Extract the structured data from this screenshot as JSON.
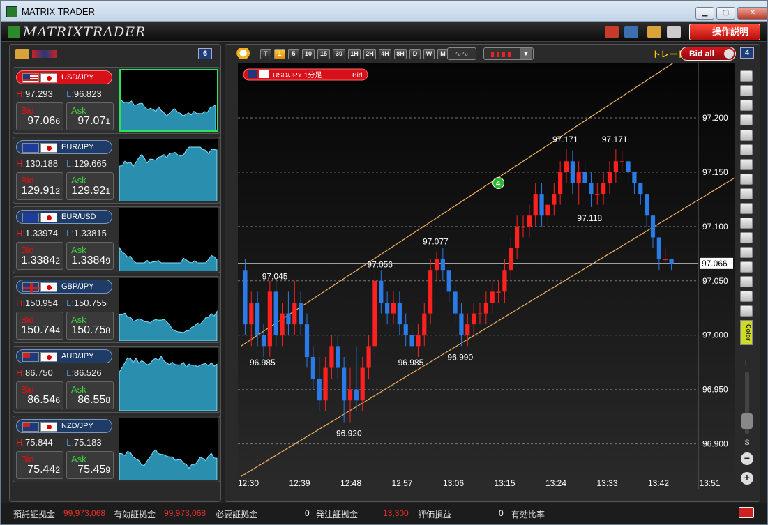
{
  "window": {
    "title": "MATRIX TRADER",
    "logo": "MATRIXTRADER"
  },
  "toolbar": {
    "help_label": "操作説明",
    "icons": [
      "briefcase-icon",
      "save-icon",
      "palette-icon",
      "printer-icon"
    ]
  },
  "left_panel": {
    "count": "6",
    "pairs": [
      {
        "name": "USD/JPY",
        "flags": [
          "us",
          "jp"
        ],
        "h": "97.293",
        "l": "96.823",
        "bid_main": "97.06",
        "bid_small": "6",
        "ask_main": "97.07",
        "ask_small": "1",
        "active": true
      },
      {
        "name": "EUR/JPY",
        "flags": [
          "eu",
          "jp"
        ],
        "h": "130.188",
        "l": "129.665",
        "bid_main": "129.91",
        "bid_small": "2",
        "ask_main": "129.92",
        "ask_small": "1",
        "active": false
      },
      {
        "name": "EUR/USD",
        "flags": [
          "eu",
          "us"
        ],
        "h": "1.33974",
        "l": "1.33815",
        "bid_main": "1.3384",
        "bid_small": "2",
        "ask_main": "1.3384",
        "ask_small": "9",
        "active": false
      },
      {
        "name": "GBP/JPY",
        "flags": [
          "gb",
          "jp"
        ],
        "h": "150.954",
        "l": "150.755",
        "bid_main": "150.74",
        "bid_small": "4",
        "ask_main": "150.75",
        "ask_small": "8",
        "active": false
      },
      {
        "name": "AUD/JPY",
        "flags": [
          "au",
          "jp"
        ],
        "h": "86.750",
        "l": "86.526",
        "bid_main": "86.54",
        "bid_small": "6",
        "ask_main": "86.55",
        "ask_small": "8",
        "active": false
      },
      {
        "name": "NZD/JPY",
        "flags": [
          "nz",
          "jp"
        ],
        "h": "75.844",
        "l": "75.183",
        "bid_main": "75.44",
        "bid_small": "2",
        "ask_main": "75.45",
        "ask_small": "9",
        "active": false
      }
    ],
    "h_prefix": "H:",
    "l_prefix": "L:",
    "bid_label": "Bid",
    "ask_label": "Ask"
  },
  "chart_toolbar": {
    "timeframes": [
      "T",
      "1",
      "5",
      "10",
      "15",
      "30",
      "1H",
      "2H",
      "4H",
      "8H",
      "D",
      "W",
      "M"
    ],
    "selected_timeframe": "1",
    "trade_label": "トレード",
    "bid_all_label": "Bid all",
    "panel_count": "4"
  },
  "chart_data": {
    "type": "candlestick",
    "title": "USD/JPY 1分足",
    "price_type": "Bid",
    "y_ticks": [
      "97.200",
      "97.150",
      "97.100",
      "97.050",
      "97.000",
      "96.950",
      "96.900"
    ],
    "ylim": [
      96.86,
      97.25
    ],
    "x_ticks": [
      "12:30",
      "12:39",
      "12:48",
      "12:57",
      "13:06",
      "13:15",
      "13:24",
      "13:33",
      "13:42",
      "13:51"
    ],
    "current_price": "97.066",
    "annotations": [
      "97.045",
      "96.985",
      "96.920",
      "97.056",
      "97.077",
      "96.985",
      "96.990",
      "97.171",
      "97.171",
      "97.118"
    ],
    "channel_marker": "4",
    "candles": [
      [
        97.06,
        97.07,
        97.0,
        97.01
      ],
      [
        97.01,
        97.04,
        96.99,
        97.03
      ],
      [
        97.03,
        97.04,
        96.99,
        97.0
      ],
      [
        97.0,
        97.01,
        96.98,
        96.99
      ],
      [
        96.99,
        97.05,
        96.98,
        97.04
      ],
      [
        97.04,
        97.05,
        96.99,
        97.0
      ],
      [
        97.0,
        97.03,
        96.99,
        97.02
      ],
      [
        97.02,
        97.04,
        97.0,
        97.01
      ],
      [
        97.01,
        97.05,
        97.0,
        97.03
      ],
      [
        97.03,
        97.04,
        97.0,
        97.01
      ],
      [
        97.01,
        97.02,
        96.97,
        96.98
      ],
      [
        96.98,
        96.99,
        96.95,
        96.96
      ],
      [
        96.96,
        96.98,
        96.93,
        96.94
      ],
      [
        96.94,
        96.98,
        96.93,
        96.97
      ],
      [
        96.97,
        97.0,
        96.96,
        96.99
      ],
      [
        96.99,
        97.0,
        96.96,
        96.97
      ],
      [
        96.97,
        96.98,
        96.92,
        96.94
      ],
      [
        96.94,
        96.97,
        96.92,
        96.95
      ],
      [
        96.95,
        96.99,
        96.93,
        96.94
      ],
      [
        96.94,
        96.98,
        96.93,
        96.97
      ],
      [
        96.97,
        97.0,
        96.96,
        96.99
      ],
      [
        96.99,
        97.06,
        96.98,
        97.05
      ],
      [
        97.05,
        97.06,
        97.02,
        97.03
      ],
      [
        97.03,
        97.04,
        97.01,
        97.02
      ],
      [
        97.02,
        97.04,
        97.01,
        97.03
      ],
      [
        97.03,
        97.04,
        97.0,
        97.01
      ],
      [
        97.01,
        97.02,
        96.99,
        97.0
      ],
      [
        97.0,
        97.01,
        96.985,
        96.99
      ],
      [
        96.99,
        97.01,
        96.98,
        97.0
      ],
      [
        97.0,
        97.03,
        96.99,
        97.02
      ],
      [
        97.02,
        97.07,
        97.01,
        97.06
      ],
      [
        97.06,
        97.077,
        97.05,
        97.07
      ],
      [
        97.07,
        97.08,
        97.05,
        97.06
      ],
      [
        97.06,
        97.06,
        97.03,
        97.04
      ],
      [
        97.04,
        97.05,
        97.01,
        97.02
      ],
      [
        97.02,
        97.03,
        96.99,
        97.0
      ],
      [
        97.0,
        97.02,
        96.99,
        97.01
      ],
      [
        97.01,
        97.03,
        97.0,
        97.02
      ],
      [
        97.02,
        97.03,
        97.01,
        97.02
      ],
      [
        97.02,
        97.04,
        97.01,
        97.03
      ],
      [
        97.03,
        97.05,
        97.02,
        97.04
      ],
      [
        97.04,
        97.05,
        97.03,
        97.04
      ],
      [
        97.04,
        97.07,
        97.03,
        97.06
      ],
      [
        97.06,
        97.09,
        97.05,
        97.08
      ],
      [
        97.08,
        97.11,
        97.07,
        97.1
      ],
      [
        97.1,
        97.11,
        97.09,
        97.1
      ],
      [
        97.1,
        97.12,
        97.09,
        97.11
      ],
      [
        97.11,
        97.14,
        97.1,
        97.13
      ],
      [
        97.13,
        97.14,
        97.1,
        97.11
      ],
      [
        97.11,
        97.13,
        97.1,
        97.12
      ],
      [
        97.12,
        97.14,
        97.11,
        97.13
      ],
      [
        97.13,
        97.16,
        97.12,
        97.15
      ],
      [
        97.15,
        97.171,
        97.14,
        97.16
      ],
      [
        97.16,
        97.17,
        97.13,
        97.14
      ],
      [
        97.14,
        97.16,
        97.12,
        97.15
      ],
      [
        97.15,
        97.16,
        97.13,
        97.14
      ],
      [
        97.14,
        97.15,
        97.118,
        97.13
      ],
      [
        97.13,
        97.14,
        97.12,
        97.13
      ],
      [
        97.13,
        97.15,
        97.12,
        97.14
      ],
      [
        97.14,
        97.16,
        97.13,
        97.15
      ],
      [
        97.15,
        97.171,
        97.14,
        97.16
      ],
      [
        97.16,
        97.17,
        97.15,
        97.16
      ],
      [
        97.16,
        97.16,
        97.14,
        97.15
      ],
      [
        97.15,
        97.15,
        97.13,
        97.14
      ],
      [
        97.14,
        97.14,
        97.12,
        97.13
      ],
      [
        97.13,
        97.13,
        97.1,
        97.11
      ],
      [
        97.11,
        97.11,
        97.08,
        97.09
      ],
      [
        97.09,
        97.09,
        97.06,
        97.07
      ],
      [
        97.07,
        97.08,
        97.066,
        97.07
      ],
      [
        97.07,
        97.07,
        97.06,
        97.066
      ]
    ],
    "up_color": "#ff2020",
    "down_color": "#2a7be8"
  },
  "side_tools": {
    "slider_top": "L",
    "slider_bottom": "S",
    "color_label": "Color"
  },
  "status_bar": {
    "items": [
      {
        "label": "預託証拠金",
        "value": "99,973,068"
      },
      {
        "label": "有効証拠金",
        "value": "99,973,068"
      },
      {
        "label": "必要証拠金",
        "value": "0"
      },
      {
        "label": "発注証拠金",
        "value": "13,300"
      },
      {
        "label": "評価損益",
        "value": "0"
      },
      {
        "label": "有効比率",
        "value": ""
      }
    ]
  }
}
